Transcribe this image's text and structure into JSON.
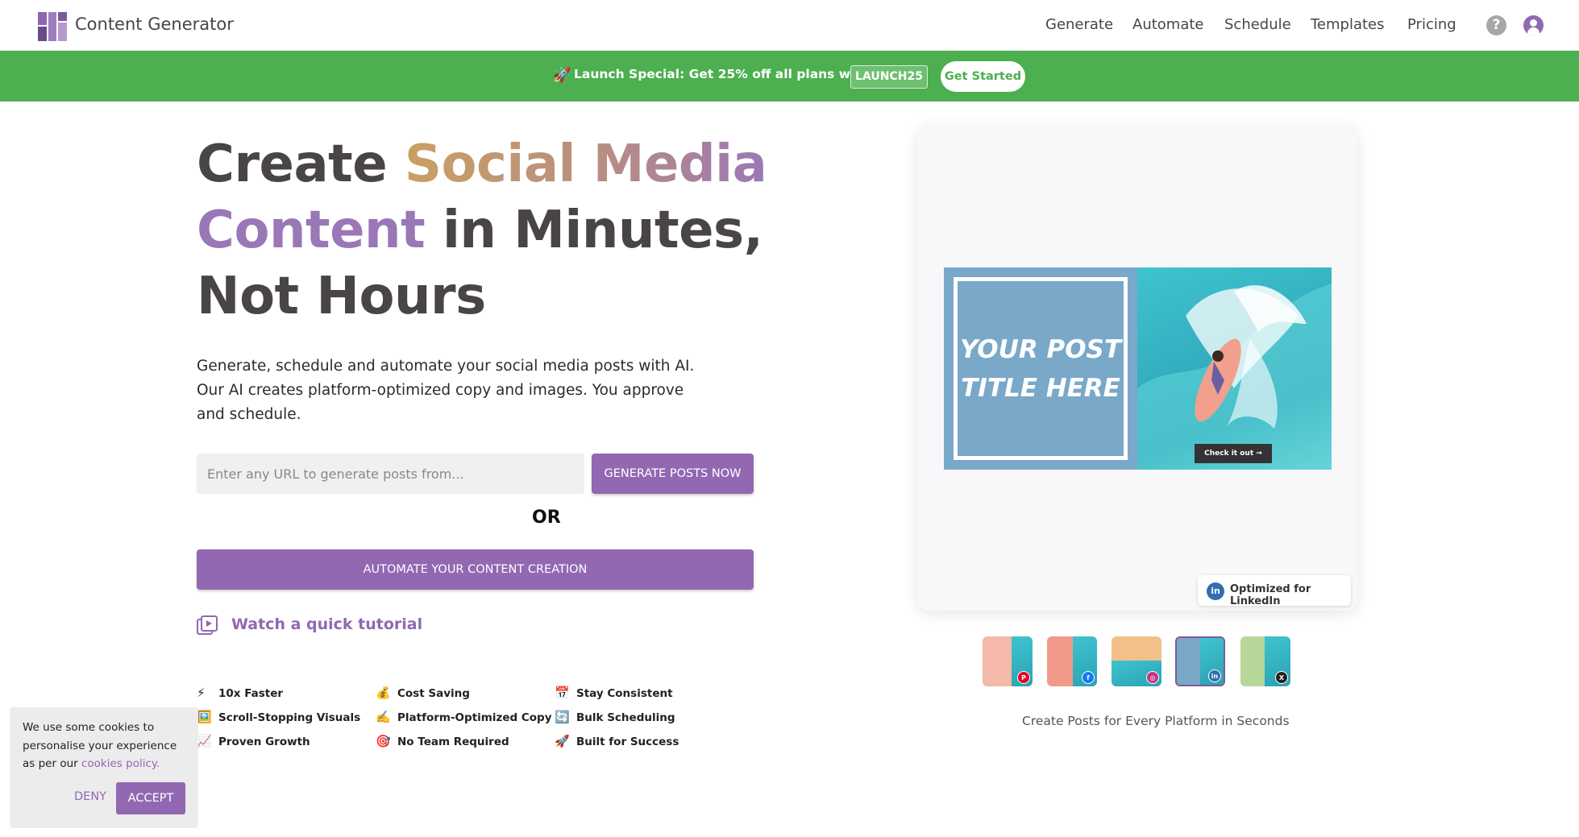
{
  "nav": {
    "brand": "Content Generator",
    "links": [
      "Generate",
      "Automate",
      "Schedule",
      "Templates",
      "Pricing"
    ],
    "help_icon": "help-circle-icon",
    "user_icon": "user-avatar-icon"
  },
  "promo": {
    "icon": "🚀",
    "text": "Launch Special: Get 25% off all plans with code",
    "code": "LAUNCH25",
    "button": "Get Started"
  },
  "hero": {
    "headline_plain_1": "Create ",
    "headline_grad": "Social Media",
    "headline_purple": "Content",
    "headline_plain_2": " in Minutes, Not Hours",
    "subtext": "Generate, schedule and automate your social media posts with AI. Our AI creates platform-optimized copy and images. You approve and schedule.",
    "url_placeholder": "Enter any URL to generate posts from...",
    "generate_button": "GENERATE POSTS NOW",
    "or_text": "OR",
    "automate_button": "AUTOMATE YOUR CONTENT CREATION",
    "tutorial_link": "Watch a quick tutorial"
  },
  "features": [
    {
      "icon": "⚡",
      "label": "10x Faster"
    },
    {
      "icon": "💰",
      "label": "Cost Saving"
    },
    {
      "icon": "📅",
      "label": "Stay Consistent"
    },
    {
      "icon": "🖼️",
      "label": "Scroll-Stopping Visuals"
    },
    {
      "icon": "✍️",
      "label": "Platform-Optimized Copy"
    },
    {
      "icon": "🔄",
      "label": "Bulk Scheduling"
    },
    {
      "icon": "📈",
      "label": "Proven Growth"
    },
    {
      "icon": "🎯",
      "label": "No Team Required"
    },
    {
      "icon": "🚀",
      "label": "Built for Success"
    }
  ],
  "preview": {
    "post_title": "YOUR POST TITLE HERE",
    "cta": "Check it out →",
    "badge": "Optimized for LinkedIn",
    "caption": "Create Posts for Every Platform in Seconds",
    "thumbnails": [
      {
        "network": "pinterest",
        "badge_color": "#e60023",
        "left_color": "#f4b9a8"
      },
      {
        "network": "facebook",
        "badge_color": "#1877f2",
        "left_color": "#f29a8a"
      },
      {
        "network": "instagram",
        "badge_color": "#c13584",
        "left_color": "#f3c08a"
      },
      {
        "network": "linkedin",
        "badge_color": "#2f6fb0",
        "left_color": "#79a8c9",
        "active": true
      },
      {
        "network": "x",
        "badge_color": "#222222",
        "left_color": "#b7d79a"
      }
    ]
  },
  "cookie": {
    "text": "We use some cookies to personalise your experience as per our",
    "link": "cookies policy.",
    "deny": "DENY",
    "accept": "ACCEPT"
  },
  "colors": {
    "primary": "#9268b2",
    "promo_green": "#4caf50",
    "text": "#4a4545"
  }
}
